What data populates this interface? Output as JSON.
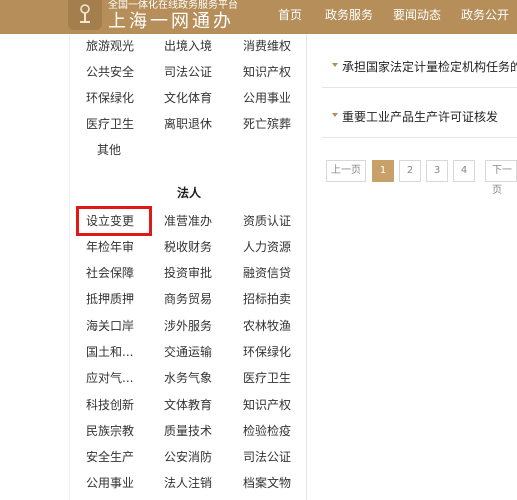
{
  "header": {
    "logo_sub": "全国一体化在线政务服务平台",
    "logo_main": "上海一网通办",
    "nav": [
      "首页",
      "政务服务",
      "要闻动态",
      "政务公开"
    ],
    "active_nav": "政务服务"
  },
  "left": {
    "top_rows": [
      [
        "旅游观光",
        "出境入境",
        "消费维权"
      ],
      [
        "公共安全",
        "司法公证",
        "知识产权"
      ],
      [
        "环保绿化",
        "文化体育",
        "公用事业"
      ],
      [
        "医疗卫生",
        "离职退休",
        "死亡殡葬"
      ],
      [
        "其他"
      ]
    ],
    "section_title": "法人",
    "legal_rows": [
      [
        "设立变更",
        "准营准办",
        "资质认证"
      ],
      [
        "年检年审",
        "税收财务",
        "人力资源"
      ],
      [
        "社会保障",
        "投资审批",
        "融资信贷"
      ],
      [
        "抵押质押",
        "商务贸易",
        "招标拍卖"
      ],
      [
        "海关口岸",
        "涉外服务",
        "农林牧渔"
      ],
      [
        "国土和...",
        "交通运输",
        "环保绿化"
      ],
      [
        "应对气...",
        "水务气象",
        "医疗卫生"
      ],
      [
        "科技创新",
        "文体教育",
        "知识产权"
      ],
      [
        "民族宗教",
        "质量技术",
        "检验检疫"
      ],
      [
        "安全生产",
        "公安消防",
        "司法公证"
      ],
      [
        "公用事业",
        "法人注销",
        "档案文物"
      ]
    ]
  },
  "right": {
    "items": [
      "承担国家法定计量检定机构任务的授",
      "重要工业产品生产许可证核发"
    ],
    "pager": {
      "prev": "上一页",
      "pages": [
        "1",
        "2",
        "3",
        "4"
      ],
      "current": "1",
      "next": "下一页"
    }
  },
  "colors": {
    "brand": "#b58e5a",
    "highlight_box": "#e01818",
    "pager_active": "#c8a06a"
  },
  "icons": {
    "logo": "shanghai-logo-icon",
    "row_arrow": "caret-down-icon"
  }
}
